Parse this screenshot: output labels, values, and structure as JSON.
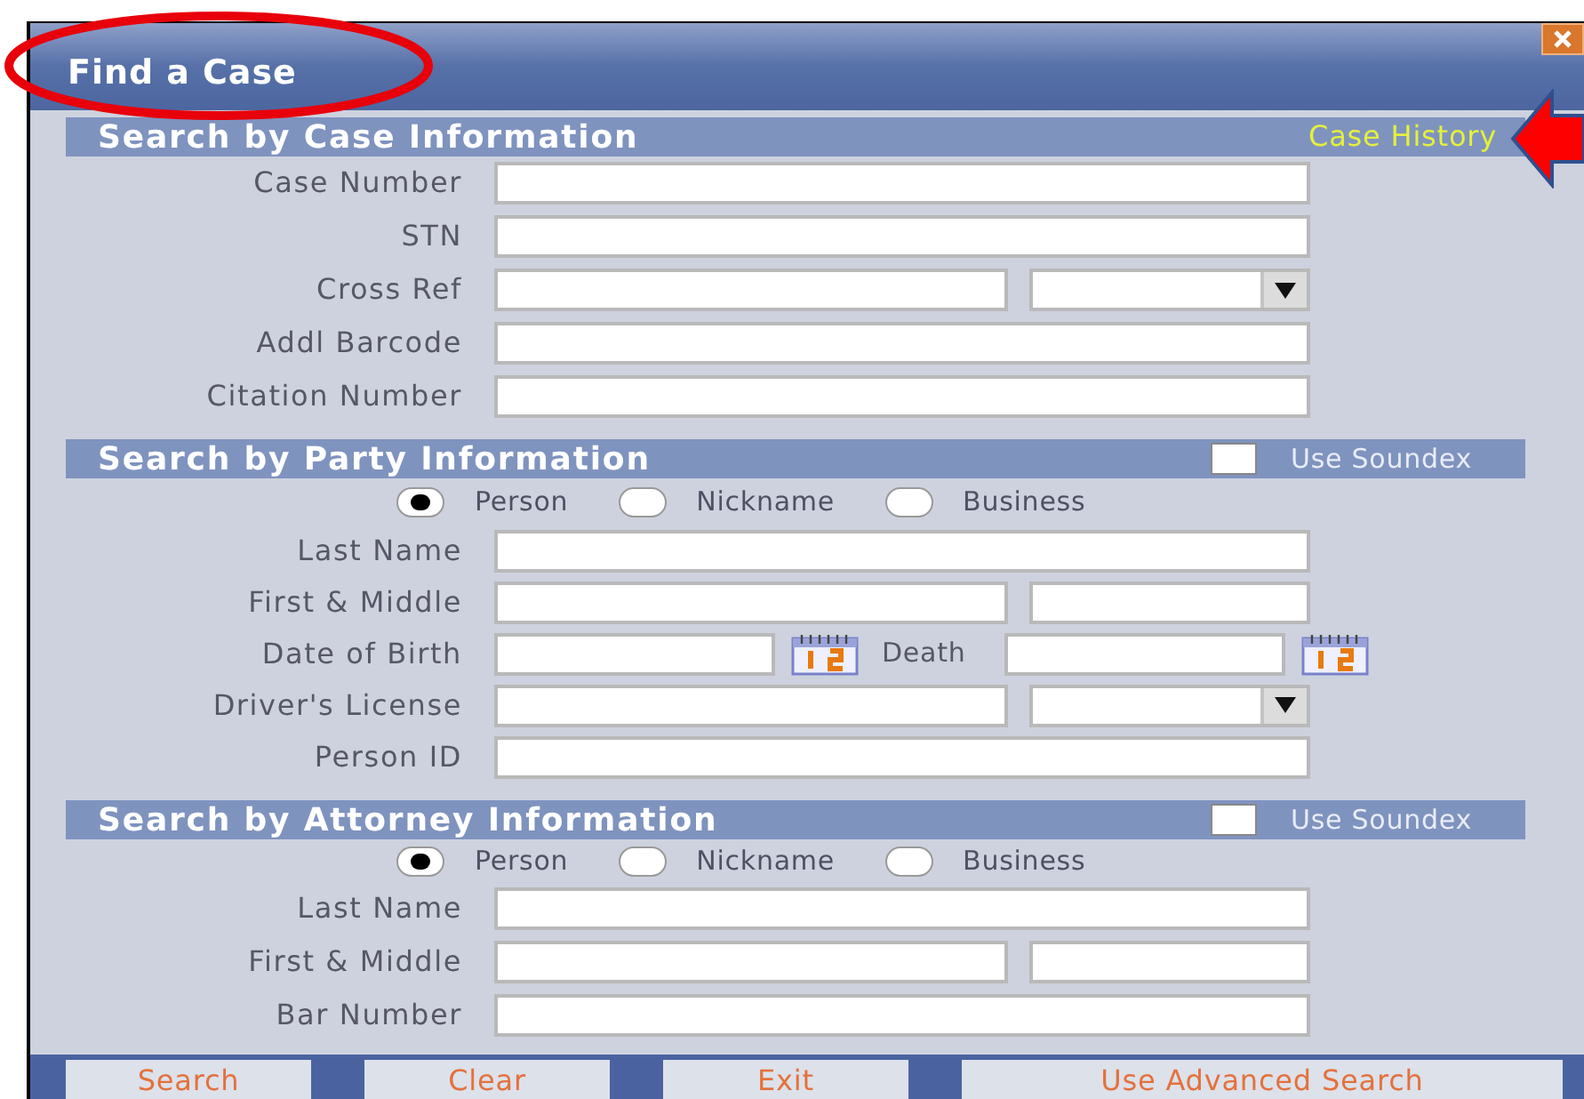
{
  "window": {
    "title": "Find a Case"
  },
  "sections": [
    {
      "title": "Search by Case Information",
      "link": "Case History",
      "rows": [
        {
          "kind": "full",
          "label": "Case Number"
        },
        {
          "kind": "full",
          "label": "STN"
        },
        {
          "kind": "select",
          "label": "Cross Ref"
        },
        {
          "kind": "full",
          "label": "Addl Barcode"
        },
        {
          "kind": "full",
          "label": "Citation Number"
        }
      ]
    },
    {
      "title": "Search by Party Information",
      "soundex": {
        "label": "Use Soundex",
        "checked": false
      },
      "radios": [
        {
          "label": "Person",
          "selected": true
        },
        {
          "label": "Nickname",
          "selected": false
        },
        {
          "label": "Business",
          "selected": false
        }
      ],
      "rows": [
        {
          "kind": "full",
          "label": "Last Name"
        },
        {
          "kind": "pair",
          "label": "First & Middle"
        },
        {
          "kind": "dates",
          "label": "Date of Birth",
          "second_label": "Death"
        },
        {
          "kind": "select",
          "label": "Driver's License"
        },
        {
          "kind": "full",
          "label": "Person ID"
        }
      ]
    },
    {
      "title": "Search by Attorney Information",
      "soundex": {
        "label": "Use Soundex",
        "checked": false
      },
      "radios": [
        {
          "label": "Person",
          "selected": true
        },
        {
          "label": "Nickname",
          "selected": false
        },
        {
          "label": "Business",
          "selected": false
        }
      ],
      "rows": [
        {
          "kind": "full",
          "label": "Last Name"
        },
        {
          "kind": "pair",
          "label": "First & Middle"
        },
        {
          "kind": "full",
          "label": "Bar Number"
        }
      ]
    }
  ],
  "buttons": [
    "Search",
    "Clear",
    "Exit",
    "Use Advanced Search"
  ]
}
